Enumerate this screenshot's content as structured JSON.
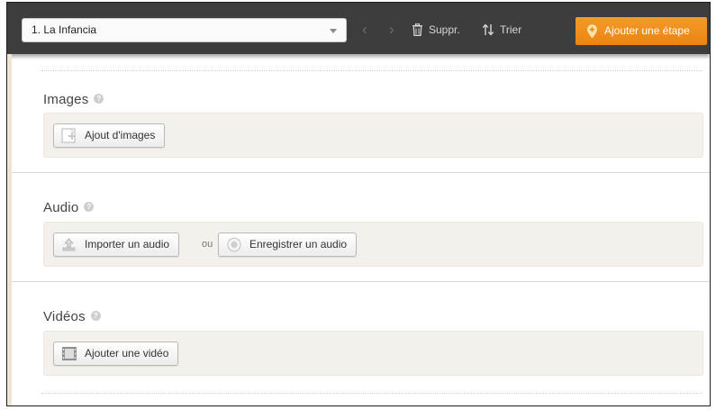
{
  "toolbar": {
    "step_select_value": "1. La Infancia",
    "delete_label": "Suppr.",
    "sort_label": "Trier",
    "add_step_label": "Ajouter une étape"
  },
  "sections": {
    "images": {
      "title": "Images",
      "add_button_label": "Ajout d'images"
    },
    "audio": {
      "title": "Audio",
      "import_button_label": "Importer un audio",
      "or_text": "ou",
      "record_button_label": "Enregistrer un audio"
    },
    "videos": {
      "title": "Vidéos",
      "add_button_label": "Ajouter une vidéo"
    }
  },
  "icons": {
    "help": "question-mark-icon",
    "prev": "chevron-left-icon",
    "next": "chevron-right-icon",
    "delete": "trash-icon",
    "sort": "sort-arrows-icon",
    "add_step": "map-pin-icon",
    "image": "image-file-icon",
    "upload": "upload-icon",
    "record": "record-icon",
    "video": "film-icon"
  },
  "colors": {
    "toolbar_bg": "#3d3d3d",
    "accent_orange": "#f0901e",
    "panel_bg": "#f4f1ec"
  }
}
